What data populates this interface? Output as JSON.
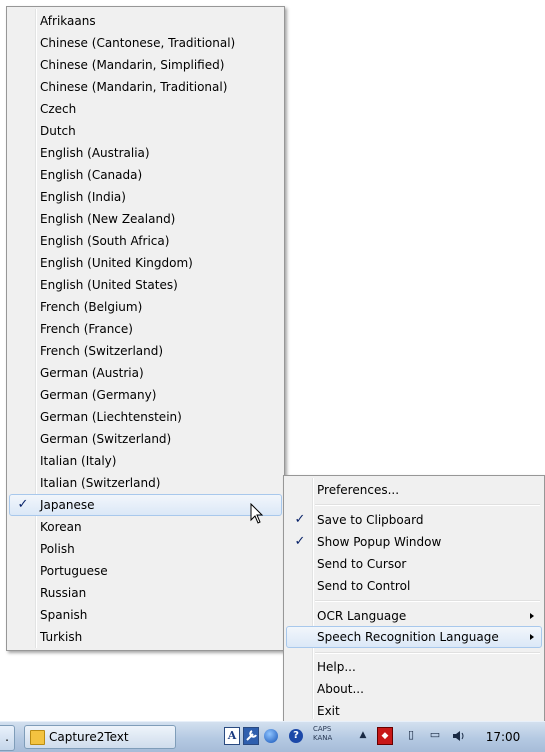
{
  "language_menu": {
    "items": [
      {
        "label": "Afrikaans",
        "checked": false
      },
      {
        "label": "Chinese (Cantonese, Traditional)",
        "checked": false
      },
      {
        "label": "Chinese (Mandarin, Simplified)",
        "checked": false
      },
      {
        "label": "Chinese (Mandarin, Traditional)",
        "checked": false
      },
      {
        "label": "Czech",
        "checked": false
      },
      {
        "label": "Dutch",
        "checked": false
      },
      {
        "label": "English (Australia)",
        "checked": false
      },
      {
        "label": "English (Canada)",
        "checked": false
      },
      {
        "label": "English (India)",
        "checked": false
      },
      {
        "label": "English (New Zealand)",
        "checked": false
      },
      {
        "label": "English (South Africa)",
        "checked": false
      },
      {
        "label": "English (United Kingdom)",
        "checked": false
      },
      {
        "label": "English (United States)",
        "checked": false
      },
      {
        "label": "French (Belgium)",
        "checked": false
      },
      {
        "label": "French (France)",
        "checked": false
      },
      {
        "label": "French (Switzerland)",
        "checked": false
      },
      {
        "label": "German (Austria)",
        "checked": false
      },
      {
        "label": "German (Germany)",
        "checked": false
      },
      {
        "label": "German (Liechtenstein)",
        "checked": false
      },
      {
        "label": "German (Switzerland)",
        "checked": false
      },
      {
        "label": "Italian (Italy)",
        "checked": false
      },
      {
        "label": "Italian (Switzerland)",
        "checked": false
      },
      {
        "label": "Japanese",
        "checked": true,
        "selected": true
      },
      {
        "label": "Korean",
        "checked": false
      },
      {
        "label": "Polish",
        "checked": false
      },
      {
        "label": "Portuguese",
        "checked": false
      },
      {
        "label": "Russian",
        "checked": false
      },
      {
        "label": "Spanish",
        "checked": false
      },
      {
        "label": "Turkish",
        "checked": false
      }
    ]
  },
  "context_menu": {
    "preferences": "Preferences...",
    "save_to_clipboard": "Save to Clipboard",
    "save_to_clipboard_checked": true,
    "show_popup_window": "Show Popup Window",
    "show_popup_window_checked": true,
    "send_to_cursor": "Send to Cursor",
    "send_to_control": "Send to Control",
    "ocr_language": "OCR Language",
    "speech_recognition_language": "Speech Recognition Language",
    "help": "Help...",
    "about": "About...",
    "exit": "Exit"
  },
  "check_glyph": "✓",
  "taskbar": {
    "left_stub": ".",
    "app_label": "Capture2Text",
    "ime_label": "A",
    "caps_label": "CAPS",
    "kana_label": "KANA",
    "clock": "17:00"
  },
  "icons": {
    "folder": "folder-icon",
    "ime_mode": "ime-mode-icon",
    "ime_tool": "ime-tool-icon",
    "ime_globe": "ime-globe-icon",
    "ime_help": "help-icon",
    "tray_expand": "tray-expand-icon",
    "volume": "volume-icon",
    "cursor": "mouse-cursor-icon"
  },
  "colors": {
    "menu_bg": "#f0f0f0",
    "check": "#0a246a",
    "selection_border": "#a8c8ec"
  }
}
